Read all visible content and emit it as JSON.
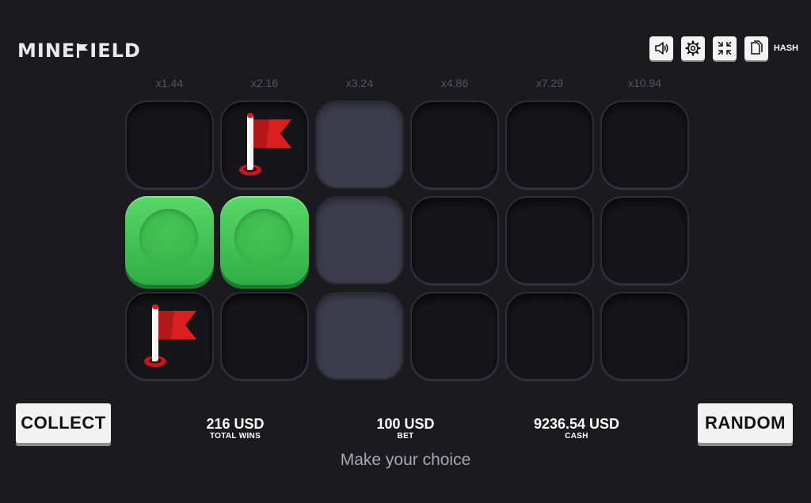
{
  "header": {
    "logo_text_before": "MINE",
    "logo_text_after": "IELD",
    "hash_label": "HASH",
    "toolbar_icons": [
      "speaker-icon",
      "gear-icon",
      "fullscreen-icon",
      "copy-icon"
    ]
  },
  "multipliers": [
    "x1.44",
    "x2.16",
    "x3.24",
    "x4.86",
    "x7.29",
    "x10.94"
  ],
  "grid": {
    "columns": 6,
    "rows": 3,
    "active_column": 3,
    "cells": [
      [
        "empty",
        "flag",
        "active",
        "empty",
        "empty",
        "empty"
      ],
      [
        "green",
        "green",
        "active",
        "empty",
        "empty",
        "empty"
      ],
      [
        "flag",
        "empty",
        "active",
        "empty",
        "empty",
        "empty"
      ]
    ]
  },
  "controls": {
    "collect_label": "COLLECT",
    "random_label": "RANDOM"
  },
  "stats": {
    "total_wins": {
      "value": "216 USD",
      "label": "TOTAL WINS"
    },
    "bet": {
      "value": "100 USD",
      "label": "BET"
    },
    "cash": {
      "value": "9236.54 USD",
      "label": "CASH"
    }
  },
  "message": "Make your choice",
  "colors": {
    "background": "#1b1a1f",
    "green_tile": "#3fc353",
    "flag_red": "#d9201f",
    "active_column": "#3d3c4c"
  }
}
